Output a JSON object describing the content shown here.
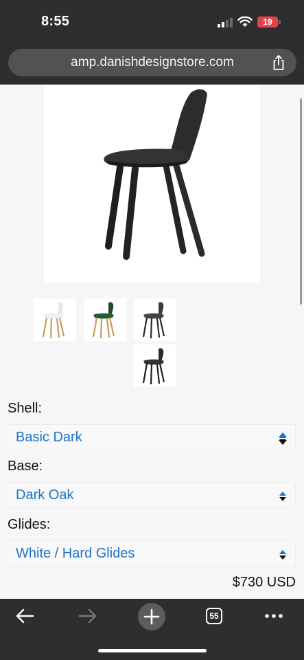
{
  "status_bar": {
    "time": "8:55",
    "battery": "19",
    "battery_color": "#e4424a"
  },
  "browser": {
    "url": "amp.danishdesignstore.com",
    "tab_count": "55"
  },
  "product": {
    "options": [
      {
        "label": "Shell:",
        "value": "Basic Dark"
      },
      {
        "label": "Base:",
        "value": "Dark Oak"
      },
      {
        "label": "Glides:",
        "value": "White / Hard Glides"
      }
    ],
    "price": "$730 USD",
    "link_color": "#1b75c6"
  },
  "icons": {
    "back": "arrow-left-icon",
    "forward": "arrow-right-icon",
    "new_tab": "plus-icon",
    "tabs": "tabs-icon",
    "more": "ellipsis-icon",
    "share": "share-icon"
  }
}
